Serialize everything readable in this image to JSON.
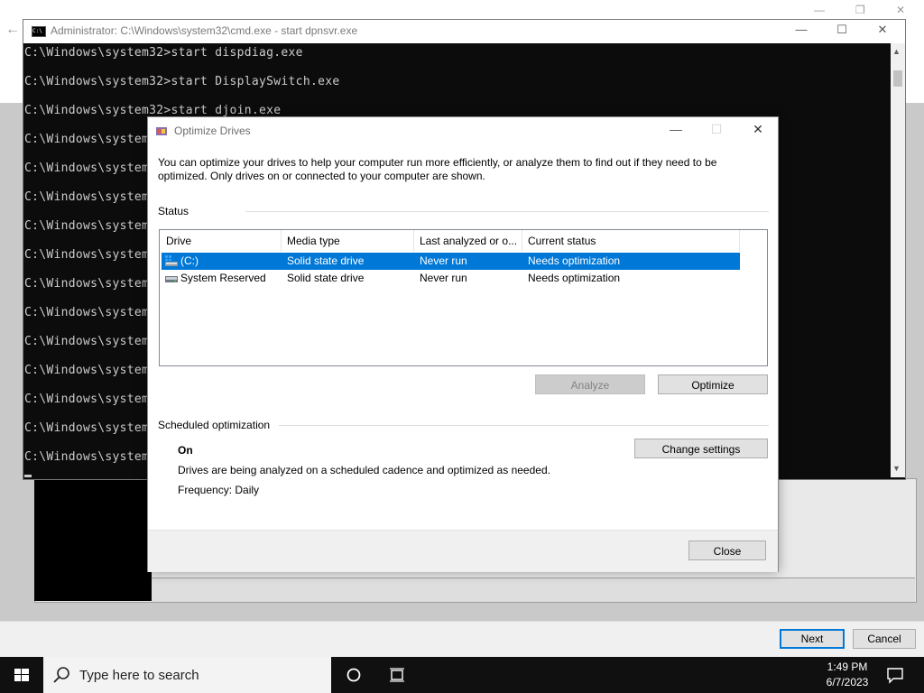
{
  "cmd": {
    "title": "Administrator: C:\\Windows\\system32\\cmd.exe - start  dpnsvr.exe",
    "lines": [
      "C:\\Windows\\system32>start dispdiag.exe",
      "C:\\Windows\\system32>start DisplaySwitch.exe",
      "C:\\Windows\\system32>start djoin.exe",
      "C:\\Windows\\system",
      "C:\\Windows\\system",
      "C:\\Windows\\system",
      "C:\\Windows\\system",
      "C:\\Windows\\system",
      "C:\\Windows\\system",
      "C:\\Windows\\system",
      "C:\\Windows\\system",
      "C:\\Windows\\system",
      "C:\\Windows\\system",
      "C:\\Windows\\system",
      "C:\\Windows\\system"
    ]
  },
  "dialog": {
    "title": "Optimize Drives",
    "description": "You can optimize your drives to help your computer run more efficiently, or analyze them to find out if they need to be optimized. Only drives on or connected to your computer are shown.",
    "status_label": "Status",
    "columns": [
      "Drive",
      "Media type",
      "Last analyzed or o...",
      "Current status"
    ],
    "drives": [
      {
        "drive": "(C:)",
        "media_type": "Solid state drive",
        "last_analyzed": "Never run",
        "status": "Needs optimization",
        "selected": true,
        "icon": "windows-drive-icon"
      },
      {
        "drive": "System Reserved",
        "media_type": "Solid state drive",
        "last_analyzed": "Never run",
        "status": "Needs optimization",
        "selected": false,
        "icon": "drive-icon"
      }
    ],
    "analyze_label": "Analyze",
    "optimize_label": "Optimize",
    "scheduled_label": "Scheduled optimization",
    "schedule_state": "On",
    "schedule_desc": "Drives are being analyzed on a scheduled cadence and optimized as needed.",
    "frequency": "Frequency: Daily",
    "change_settings_label": "Change settings",
    "close_label": "Close"
  },
  "wizard": {
    "next_label": "Next",
    "cancel_label": "Cancel"
  },
  "taskbar": {
    "search_placeholder": "Type here to search",
    "time": "1:49 PM",
    "date": "6/7/2023"
  },
  "colors": {
    "selection": "#0078d7",
    "cmd_bg": "#0c0c0c",
    "taskbar_bg": "#101010"
  }
}
